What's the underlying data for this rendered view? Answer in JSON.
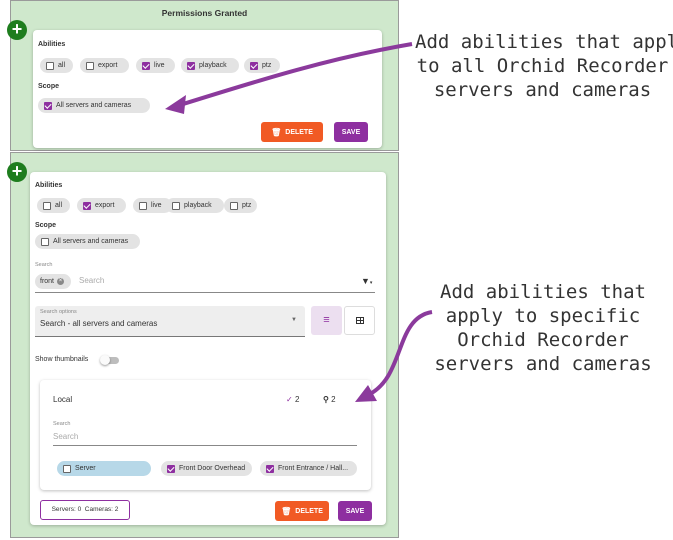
{
  "top_panel": {
    "title": "Permissions Granted",
    "abilities_label": "Abilities",
    "abilities": [
      {
        "label": "all",
        "checked": false
      },
      {
        "label": "export",
        "checked": false
      },
      {
        "label": "live",
        "checked": true
      },
      {
        "label": "playback",
        "checked": true
      },
      {
        "label": "ptz",
        "checked": true
      }
    ],
    "scope_label": "Scope",
    "scope_chip": {
      "label": "All servers and cameras",
      "checked": true
    },
    "delete_label": "DELETE",
    "save_label": "SAVE"
  },
  "bottom_panel": {
    "abilities_label": "Abilities",
    "abilities": [
      {
        "label": "all",
        "checked": false
      },
      {
        "label": "export",
        "checked": true
      },
      {
        "label": "live",
        "checked": false
      },
      {
        "label": "playback",
        "checked": false
      },
      {
        "label": "ptz",
        "checked": false
      }
    ],
    "scope_label": "Scope",
    "scope_chip": {
      "label": "All servers and cameras",
      "checked": false
    },
    "search_label": "Search",
    "search_tag": "front",
    "search_placeholder": "Search",
    "search_options_label": "Search options",
    "search_options_value": "Search - all servers and cameras",
    "show_thumbnails_label": "Show thumbnails",
    "local_card": {
      "title": "Local",
      "check_count": "2",
      "search_count": "2",
      "search_label": "Search",
      "search_placeholder": "Search",
      "chips": [
        {
          "label": "Server",
          "checked": false
        },
        {
          "label": "Front Door Overhead",
          "checked": true
        },
        {
          "label": "Front Entrance / Hall...",
          "checked": true
        }
      ]
    },
    "summary": "Servers: 0  Cameras: 2",
    "delete_label": "DELETE",
    "save_label": "SAVE"
  },
  "annotations": {
    "top": [
      "Add abilities that apply",
      "to all Orchid Recorder",
      "servers and cameras"
    ],
    "bottom": [
      "Add abilities that",
      "apply to specific",
      "Orchid Recorder",
      "servers and cameras"
    ]
  },
  "colors": {
    "accent": "#8e2fa0",
    "delete": "#f15a24",
    "panel": "#cfe8cc",
    "add": "#1e7d1e"
  }
}
